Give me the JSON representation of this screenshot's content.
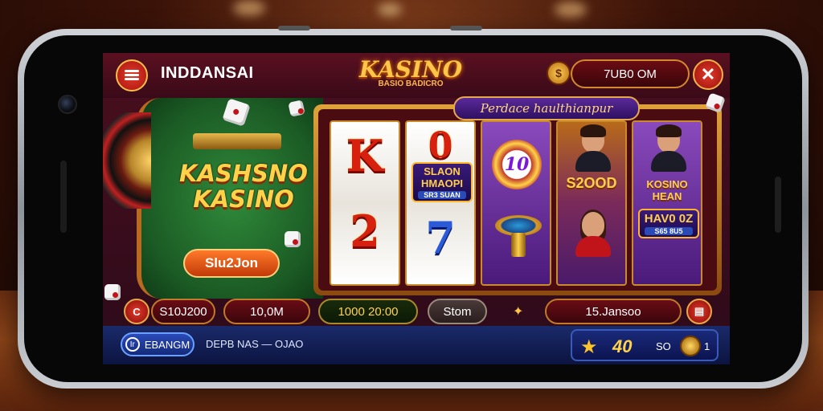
{
  "header": {
    "app_title": "INDDANSAI",
    "logo_main": "KASINO",
    "logo_sub": "BASIO BADICRO",
    "balance": "7UB0 OM"
  },
  "promo": {
    "title_line1": "KASHSNO",
    "title_line2": "KASINO",
    "button_label": "Slu2Jon"
  },
  "slot": {
    "header": "Perdace haulthianpur",
    "reels": [
      {
        "top": "K",
        "bottom": "2"
      },
      {
        "top": "0",
        "badge": "SLAON HMAOPI",
        "badge_small": "SR3 SUAN",
        "bottom": "7"
      },
      {
        "chip": "10"
      },
      {
        "label": "S2OOD"
      },
      {
        "label": "KOSINO HEAN",
        "badge": "HAV0 0Z",
        "badge_small": "S65 8U5"
      }
    ]
  },
  "info_row": {
    "icon_left": "C",
    "pill1": "S10J200",
    "pill2": "10,0M",
    "pill3": "1000 20:00",
    "pill4": "Stom",
    "pill5": "15.Jansoo"
  },
  "navbar": {
    "button_label": "EBANGM",
    "button_icon": "Ir",
    "text": "DEPB NAS  —  OJAO",
    "score": "40",
    "score_small": "SO",
    "count": "1"
  },
  "colors": {
    "accent_gold": "#ffc64a",
    "accent_red": "#c0141a",
    "promo_green": "#1b5a24",
    "nav_blue": "#142a7a"
  }
}
